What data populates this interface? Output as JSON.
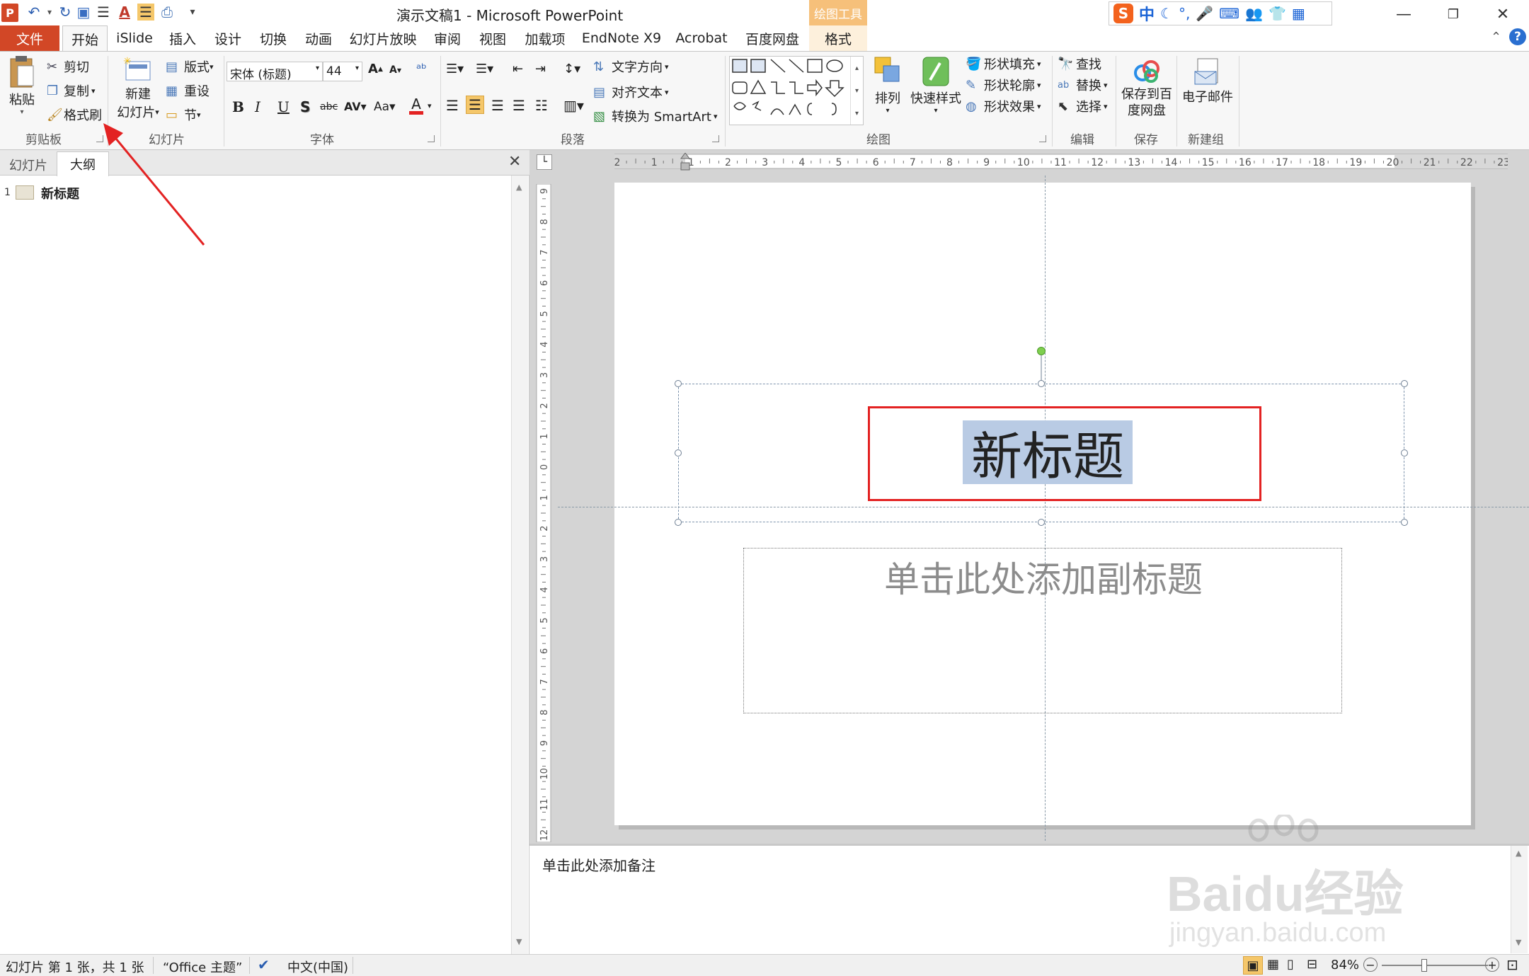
{
  "window": {
    "title": "演示文稿1 - Microsoft PowerPoint",
    "contextual_group": "绘图工具"
  },
  "ime": {
    "label": "中"
  },
  "tabs": [
    {
      "label": "文件"
    },
    {
      "label": "开始"
    },
    {
      "label": "iSlide"
    },
    {
      "label": "插入"
    },
    {
      "label": "设计"
    },
    {
      "label": "切换"
    },
    {
      "label": "动画"
    },
    {
      "label": "幻灯片放映"
    },
    {
      "label": "审阅"
    },
    {
      "label": "视图"
    },
    {
      "label": "加载项"
    },
    {
      "label": "EndNote X9"
    },
    {
      "label": "Acrobat"
    },
    {
      "label": "百度网盘"
    },
    {
      "label": "格式"
    }
  ],
  "ribbon": {
    "clipboard": {
      "paste": "粘贴",
      "cut": "剪切",
      "copy": "复制",
      "format_painter": "格式刷",
      "group": "剪贴板"
    },
    "slides": {
      "new_slide_1": "新建",
      "new_slide_2": "幻灯片",
      "layout": "版式",
      "reset": "重设",
      "section": "节",
      "group": "幻灯片"
    },
    "font": {
      "name": "宋体 (标题)",
      "size": "44",
      "group": "字体"
    },
    "paragraph": {
      "text_direction": "文字方向",
      "align_text": "对齐文本",
      "smartart": "转换为 SmartArt",
      "group": "段落"
    },
    "drawing": {
      "arrange": "排列",
      "quick_styles": "快速样式",
      "shape_fill": "形状填充",
      "shape_outline": "形状轮廓",
      "shape_effects": "形状效果",
      "group": "绘图"
    },
    "editing": {
      "find": "查找",
      "replace": "替换",
      "select": "选择",
      "group": "编辑"
    },
    "save": {
      "save_baidu_1": "保存到百",
      "save_baidu_2": "度网盘",
      "group": "保存"
    },
    "newgroup": {
      "email": "电子邮件",
      "group": "新建组"
    }
  },
  "left_pane": {
    "tab_slides": "幻灯片",
    "tab_outline": "大纲",
    "outline_number": "1",
    "outline_title": "新标题"
  },
  "ruler": {
    "h_ticks": [
      "2",
      "1",
      "1",
      "2",
      "3",
      "4",
      "5",
      "6",
      "7",
      "8",
      "9",
      "10",
      "11",
      "12",
      "13",
      "14",
      "15",
      "16",
      "17",
      "18",
      "19",
      "20",
      "21",
      "22",
      "23"
    ],
    "v_ticks": [
      "9",
      "8",
      "7",
      "6",
      "5",
      "4",
      "3",
      "2",
      "1",
      "0",
      "1",
      "2",
      "3",
      "4",
      "5",
      "6",
      "7",
      "8",
      "9",
      "10",
      "11",
      "12"
    ]
  },
  "slide": {
    "title": "新标题",
    "subtitle_placeholder": "单击此处添加副标题"
  },
  "notes": {
    "placeholder": "单击此处添加备注"
  },
  "status": {
    "slide_info": "幻灯片 第 1 张，共 1 张",
    "theme": "“Office 主题”",
    "language": "中文(中国)",
    "zoom": "84%"
  },
  "watermark": {
    "brand": "Baidu经验",
    "url": "jingyan.baidu.com"
  },
  "colors": {
    "file_tab": "#d24726",
    "contextual": "#f6c07a",
    "annotation_red": "#e32222",
    "selection": "#b9cbe4"
  }
}
